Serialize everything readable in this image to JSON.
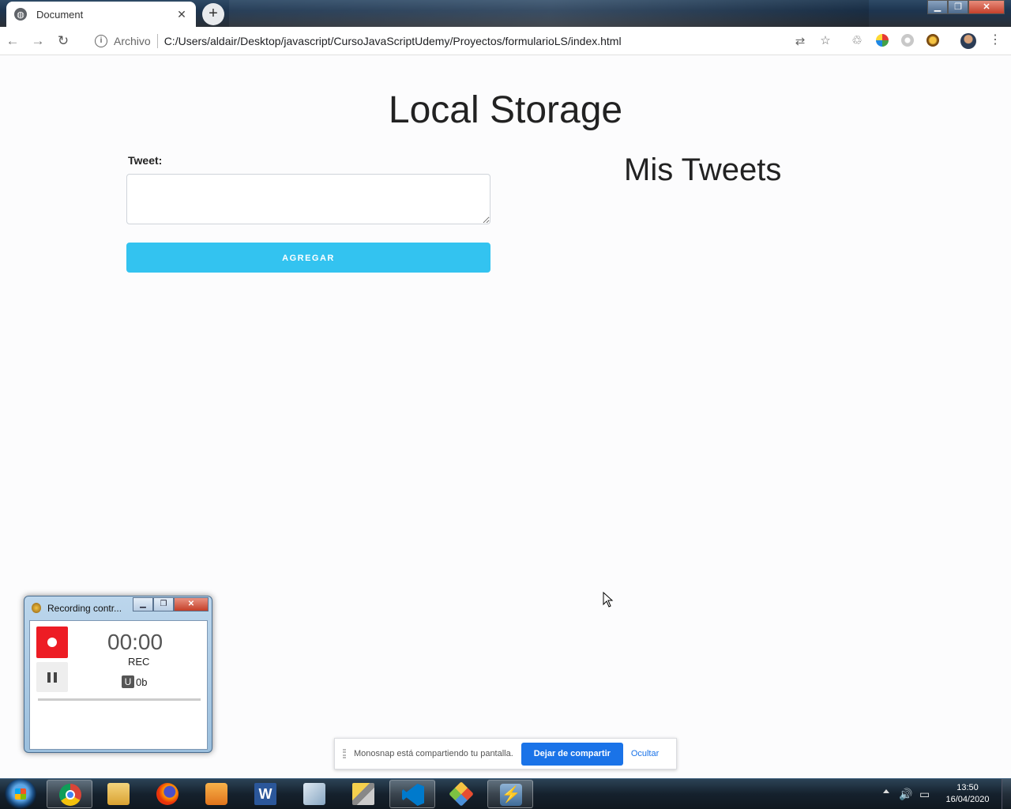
{
  "browser": {
    "tab_title": "Document",
    "tab_close": "✕",
    "new_tab": "+",
    "omnibox": {
      "security_label": "Archivo",
      "url": "C:/Users/aldair/Desktop/javascript/CursoJavaScriptUdemy/Proyectos/formularioLS/index.html"
    },
    "icons": [
      "back-arrow-icon",
      "forward-arrow-icon",
      "reload-icon",
      "info-icon",
      "translate-icon",
      "star-icon",
      "recycle-icon",
      "color-wheel-icon",
      "extension-icon",
      "monosnap-icon",
      "profile-avatar",
      "menu-icon"
    ]
  },
  "page": {
    "title": "Local Storage",
    "tweet_label": "Tweet:",
    "add_button": "AGREGAR",
    "my_tweets_title": "Mis Tweets",
    "accent_color": "#33c3f0"
  },
  "recording_window": {
    "title": "Recording contr...",
    "timer": "00:00",
    "status": "REC",
    "size_badge": "U",
    "size": "0b",
    "record_color": "#ed1c24"
  },
  "share_notification": {
    "message": "Monosnap está compartiendo tu pantalla.",
    "stop_button": "Dejar de compartir",
    "hide_link": "Ocultar"
  },
  "taskbar": {
    "apps": [
      "chrome-icon",
      "explorer-icon",
      "firefox-icon",
      "media-player-icon",
      "word-icon",
      "virtualbox-icon",
      "tools-icon",
      "vscode-icon",
      "git-icon",
      "monosnap-icon"
    ],
    "clock_time": "13:50",
    "clock_date": "16/04/2020"
  }
}
